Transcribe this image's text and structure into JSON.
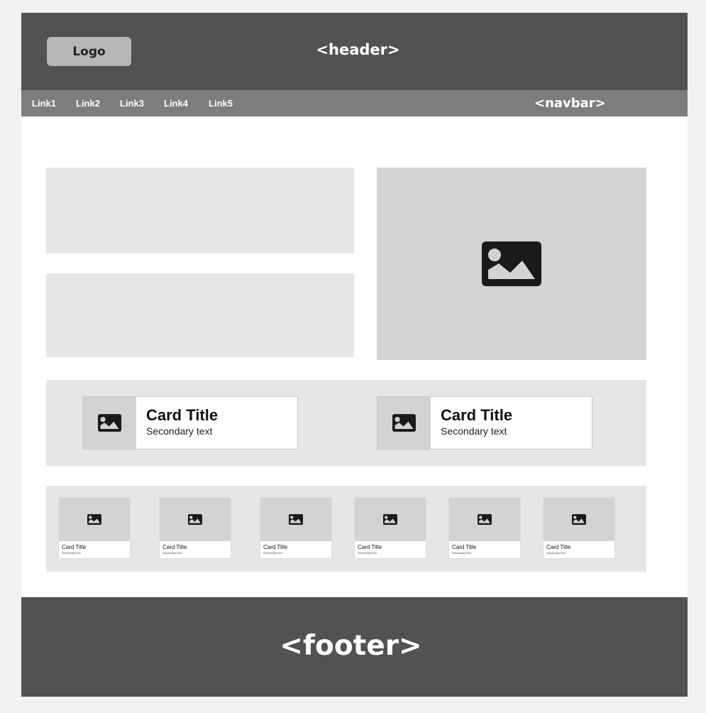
{
  "header": {
    "logo_label": "Logo",
    "tag": "<header>"
  },
  "navbar": {
    "links": [
      "Link1",
      "Link2",
      "Link3",
      "Link4",
      "Link5"
    ],
    "tag": "<navbar>"
  },
  "hero": {
    "image_icon": "image-icon"
  },
  "cards": [
    {
      "title": "Card Title",
      "secondary": "Secondary text",
      "icon": "image-icon"
    },
    {
      "title": "Card Title",
      "secondary": "Secondary text",
      "icon": "image-icon"
    }
  ],
  "mini_cards": [
    {
      "title": "Card Title",
      "secondary": "Secondary text"
    },
    {
      "title": "Card Title",
      "secondary": "Secondary text"
    },
    {
      "title": "Card Title",
      "secondary": "Secondary text"
    },
    {
      "title": "Card Title",
      "secondary": "Secondary text"
    },
    {
      "title": "Card Title",
      "secondary": "Secondary text"
    },
    {
      "title": "Card Title",
      "secondary": "Secondary text"
    }
  ],
  "footer": {
    "tag": "<footer>"
  },
  "colors": {
    "header_bg": "#525252",
    "navbar_bg": "#7d7d7d",
    "placeholder_light": "#e6e6e6",
    "placeholder_image": "#d3d3d3",
    "icon": "#1a1a1a"
  }
}
